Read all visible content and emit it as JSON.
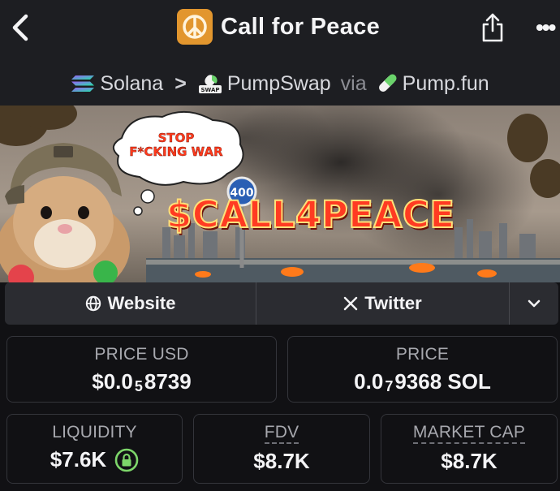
{
  "header": {
    "title": "Call for Peace",
    "logo_icon": "peace-sign-icon",
    "back_icon": "chevron-left-icon",
    "share_icon": "share-icon",
    "more_label": "•••"
  },
  "breadcrumb": {
    "chain": "Solana",
    "separator": ">",
    "dex": "PumpSwap",
    "via": "via",
    "launchpad": "Pump.fun"
  },
  "banner": {
    "ticker": "$CALL4PEACE",
    "bubble_line1": "STOP",
    "bubble_line2": "F*CKING WAR",
    "sign_number": "400"
  },
  "links": {
    "website_label": "Website",
    "twitter_label": "Twitter",
    "expand_icon": "chevron-down-icon"
  },
  "stats": {
    "price_usd": {
      "label": "PRICE USD",
      "prefix": "$0.0",
      "zeros": "5",
      "digits": "8739"
    },
    "price_sol": {
      "label": "PRICE",
      "prefix": "0.0",
      "zeros": "7",
      "digits": "9368 SOL"
    },
    "liquidity": {
      "label": "LIQUIDITY",
      "value": "$7.6K",
      "icon": "lock-icon"
    },
    "fdv": {
      "label": "FDV",
      "value": "$8.7K"
    },
    "market_cap": {
      "label": "MARKET CAP",
      "value": "$8.7K"
    }
  },
  "colors": {
    "background": "#111114",
    "header_bg": "#1d1e22",
    "accent_green": "#7dd66a",
    "ticker_red": "#ff3b22"
  }
}
